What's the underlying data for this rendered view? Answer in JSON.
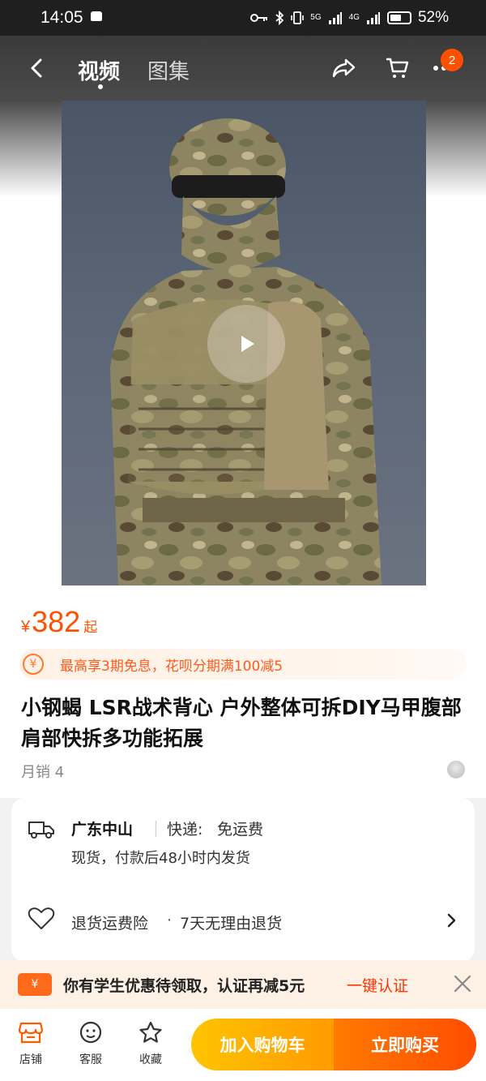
{
  "status_bar": {
    "time": "14:05",
    "network_5g": "5G",
    "network_4g": "4G",
    "battery": "52%"
  },
  "nav": {
    "tabs": [
      {
        "label": "视频",
        "active": true
      },
      {
        "label": "图集",
        "active": false
      }
    ],
    "cart_badge": "2",
    "icons": [
      "back-arrow-icon",
      "share-icon",
      "cart-icon",
      "more-icon"
    ]
  },
  "product": {
    "currency": "¥",
    "price": "382",
    "price_suffix": "起",
    "promo_text": "最高享3期免息，花呗分期满100减5",
    "title": "小钢蝎 LSR战术背心 户外整体可拆DIY马甲腹部肩部快拆多功能拓展",
    "monthly_sales": "月销 4"
  },
  "delivery": {
    "location": "广东中山",
    "shipping_label": "快递:",
    "shipping_value": "免运费",
    "dispatch_note": "现货，付款后48小时内发货",
    "insurance": "退货运费险",
    "dot": "·",
    "return_policy": "7天无理由退货"
  },
  "student_bar": {
    "text": "你有学生优惠待领取，认证再减5元",
    "link": "一键认证"
  },
  "bottom_bar": {
    "shop": "店铺",
    "service": "客服",
    "favorite": "收藏",
    "add_to_cart": "加入购物车",
    "buy_now": "立即购买"
  },
  "colors": {
    "accent": "#ff5000",
    "promo_text": "#ff5a1a",
    "cart_button": "#ffb000",
    "buy_button": "#ff5a00"
  }
}
